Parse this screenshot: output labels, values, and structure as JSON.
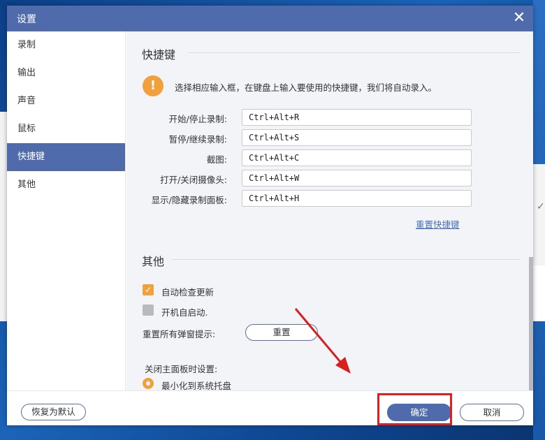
{
  "dialog": {
    "title": "设置"
  },
  "sidebar": {
    "items": [
      {
        "label": "录制"
      },
      {
        "label": "输出"
      },
      {
        "label": "声音"
      },
      {
        "label": "鼠标"
      },
      {
        "label": "快捷键",
        "active": true
      },
      {
        "label": "其他"
      }
    ]
  },
  "hotkeys": {
    "section_title": "快捷键",
    "info_text": "选择相应输入框，在键盘上输入要使用的快捷键，我们将自动录入。",
    "rows": [
      {
        "label": "开始/停止录制:",
        "value": "Ctrl+Alt+R"
      },
      {
        "label": "暂停/继续录制:",
        "value": "Ctrl+Alt+S"
      },
      {
        "label": "截图:",
        "value": "Ctrl+Alt+C"
      },
      {
        "label": "打开/关闭摄像头:",
        "value": "Ctrl+Alt+W"
      },
      {
        "label": "显示/隐藏录制面板:",
        "value": "Ctrl+Alt+H"
      }
    ],
    "reset_link": "重置快捷键"
  },
  "other": {
    "section_title": "其他",
    "auto_update_label": "自动检查更新",
    "auto_update_checked": true,
    "autostart_label": "开机自启动.",
    "autostart_checked": false,
    "reset_popups_label": "重置所有弹窗提示:",
    "reset_button": "重置",
    "close_panel_label": "关闭主面板时设置:",
    "minimize_option": "最小化到系统托盘"
  },
  "footer": {
    "restore_default": "恢复为默认",
    "ok": "确定",
    "cancel": "取消"
  },
  "colors": {
    "accent": "#4f6bab",
    "orange": "#f0a13c",
    "highlight": "#e02020"
  }
}
